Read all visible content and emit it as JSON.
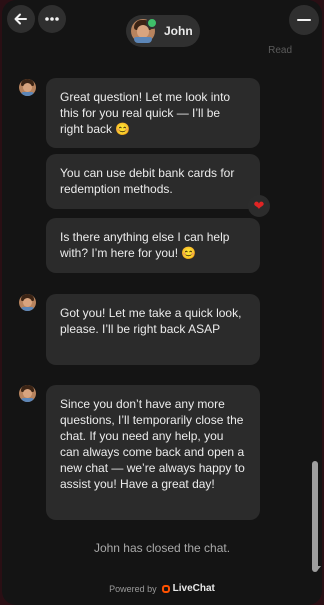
{
  "header": {
    "agent_name": "John",
    "read_label": "Read"
  },
  "messages": [
    {
      "text": "Great question! Let me look into this for you real quick — I’ll be right back 😊"
    },
    {
      "text": "You can use debit bank cards for redemption methods."
    },
    {
      "text": "Is there anything else I can help with? I’m here for you! 😊"
    },
    {
      "text": "Got you! Let me take a quick look, please. I’ll be right back ASAP"
    },
    {
      "text": "Since you don’t have any more questions, I’ll temporarily close the chat. If you need any help, you can always come back and open a new chat — we’re always happy to assist you! Have a great day!"
    }
  ],
  "reaction": {
    "emoji": "❤"
  },
  "status": {
    "closed_text": "John has closed the chat."
  },
  "footer": {
    "powered_by": "Powered by",
    "brand": "LiveChat"
  },
  "colors": {
    "accent": "#ff5100",
    "online": "#3fc06a",
    "heart": "#e02424"
  }
}
